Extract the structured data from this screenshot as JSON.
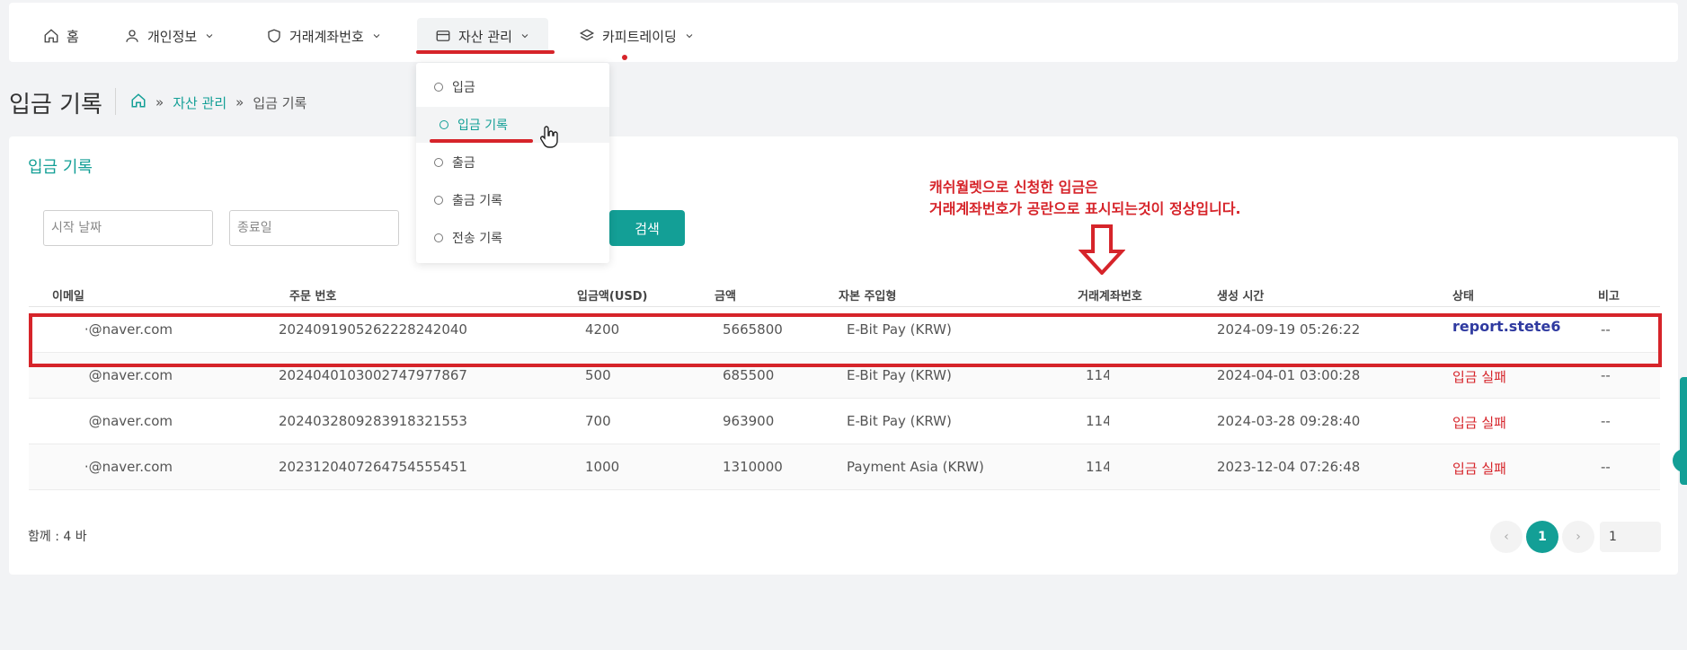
{
  "nav": {
    "home": "홈",
    "personal": "개인정보",
    "account": "거래계좌번호",
    "asset": "자산 관리",
    "copy": "카피트레이딩"
  },
  "dropdown": {
    "items": [
      "입금",
      "입금 기록",
      "출금",
      "출금 기록",
      "전송 기록"
    ]
  },
  "page": {
    "title": "입금 기록",
    "breadcrumb_parent": "자산 관리",
    "breadcrumb_sep": "»",
    "breadcrumb_current": "입금 기록"
  },
  "card": {
    "title": "입금 기록",
    "start_placeholder": "시작 날짜",
    "end_placeholder": "종료일",
    "search_label": "검색"
  },
  "annotation": {
    "line1": "캐쉬월렛으로 신청한 입금은",
    "line2": "거래계좌번호가 공란으로 표시되는것이 정상입니다."
  },
  "table": {
    "headers": [
      "이메일",
      "주문 번호",
      "입금액(USD)",
      "금액",
      "자본 주입형",
      "거래계좌번호",
      "생성 시간",
      "상태",
      "비고"
    ],
    "rows": [
      {
        "email": "·@naver.com",
        "order": "20240919052622282420​40",
        "usd": "4200",
        "amount": "5665800",
        "type": "E-Bit Pay (KRW)",
        "account": "",
        "time": "2024-09-19 05:26:22",
        "status": "report.stete6",
        "note": "--"
      },
      {
        "email": "@naver.com",
        "order": "2024040103002747977867",
        "usd": "500",
        "amount": "685500",
        "type": "E-Bit Pay (KRW)",
        "account": "114",
        "time": "2024-04-01 03:00:28",
        "status": "입금 실패",
        "note": "--"
      },
      {
        "email": "@naver.com",
        "order": "2024032809283918321553",
        "usd": "700",
        "amount": "963900",
        "type": "E-Bit Pay (KRW)",
        "account": "114",
        "time": "2024-03-28 09:28:40",
        "status": "입금 실패",
        "note": "--"
      },
      {
        "email": "·@naver.com",
        "order": "2023120407264754555451",
        "usd": "1000",
        "amount": "1310000",
        "type": "Payment Asia (KRW)",
        "account": "114",
        "time": "2023-12-04 07:26:48",
        "status": "입금 실패",
        "note": "--"
      }
    ]
  },
  "footer": {
    "total": "함께 : 4 바",
    "prev": "‹",
    "current_page": "1",
    "next": "›",
    "page_input": "1"
  },
  "colors": {
    "accent": "#139f96",
    "annotation_red": "#d6242a",
    "status_code_blue": "#2f3aa0"
  }
}
